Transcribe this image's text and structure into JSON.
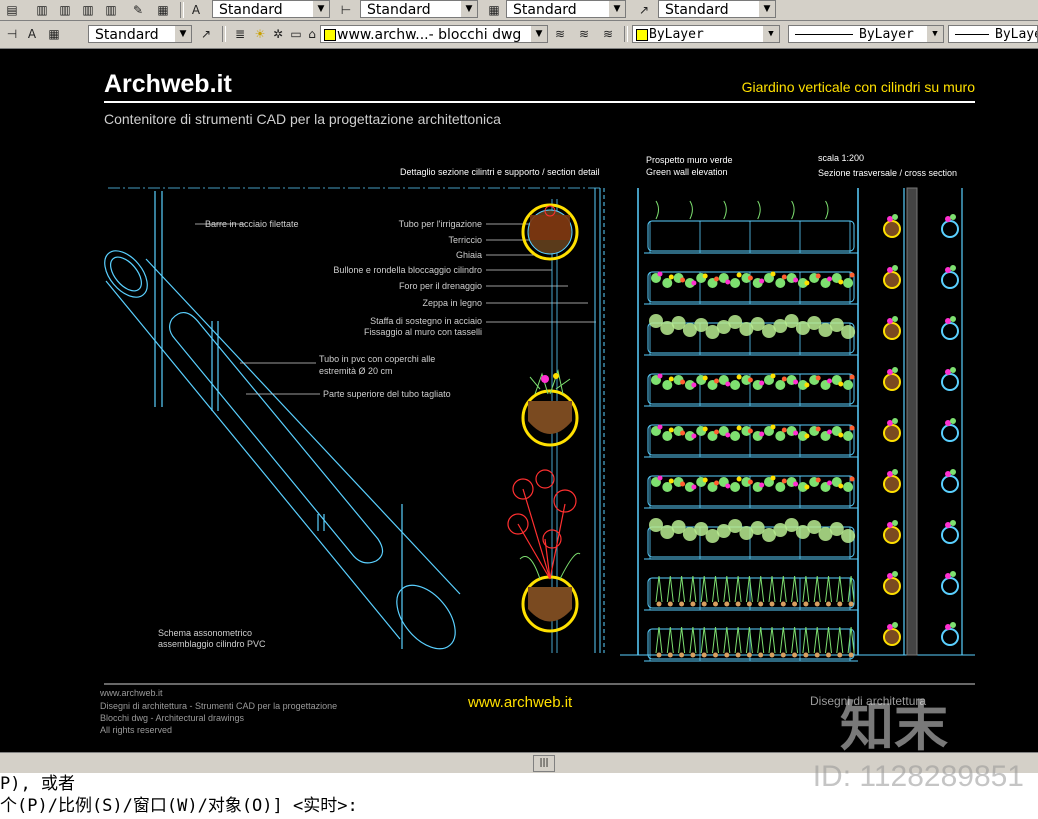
{
  "toolbar1": {
    "text_style": "Standard",
    "dim_style": "Standard",
    "table_style": "Standard",
    "multileader_style": "Standard"
  },
  "toolbar2": {
    "visual_style": "Standard",
    "layer": "www.archw...- blocchi dwg",
    "color": "ByLayer",
    "linetype": "ByLayer",
    "lineweight": "ByLaye"
  },
  "drawing": {
    "logo": "Archweb.it",
    "subtitle": "Contenitore di strumenti CAD per la progettazione architettonica",
    "title_right": "Giardino verticale con cilindri su muro",
    "section_detail": "Dettaglio sezione cilintri e supporto  / section detail",
    "elevation_it": "Prospetto muro verde",
    "elevation_en": "Green wall elevation",
    "scale": "scala 1:200",
    "cross_section": "Sezione trasversale  /  cross section",
    "label_barre": "Barre in acciaio filettate",
    "label_tubo_pvc_1": "Tubo in pvc con coperchi alle",
    "label_tubo_pvc_2": "estremità  Ø 20 cm",
    "label_parte": "Parte superiore del tubo tagliato",
    "schema_1": "Schema assonometrico",
    "schema_2": "assemblaggio cilindro PVC",
    "detail_labels": [
      "Tubo per l'irrigazione",
      "Terriccio",
      "Ghiaia",
      "Bullone e rondella bloccaggio cilindro",
      "Foro per il drenaggio",
      "Zeppa in legno",
      "Staffa di sostegno in acciaio",
      "Fissaggio al muro con tasselli"
    ],
    "footer_lines": [
      "www.archweb.it",
      "Disegni di architettura - Strumenti CAD  per la progettazione",
      "Blocchi dwg - Architectural drawings",
      "All rights reserved"
    ],
    "footer_url": "www.archweb.it",
    "footer_right": "Disegni di architettura"
  },
  "command": {
    "line1": "P), 或者",
    "line2": "个(P)/比例(S)/窗口(W)/对象(O)] <实时>:"
  },
  "watermark": {
    "id": "ID: 1128289851",
    "logo": "知末"
  },
  "colors": {
    "cyan": "#5ad0ff",
    "yellow": "#ffe000",
    "green": "#7ee070",
    "magenta": "#ff30d0",
    "red": "#ff3030"
  }
}
